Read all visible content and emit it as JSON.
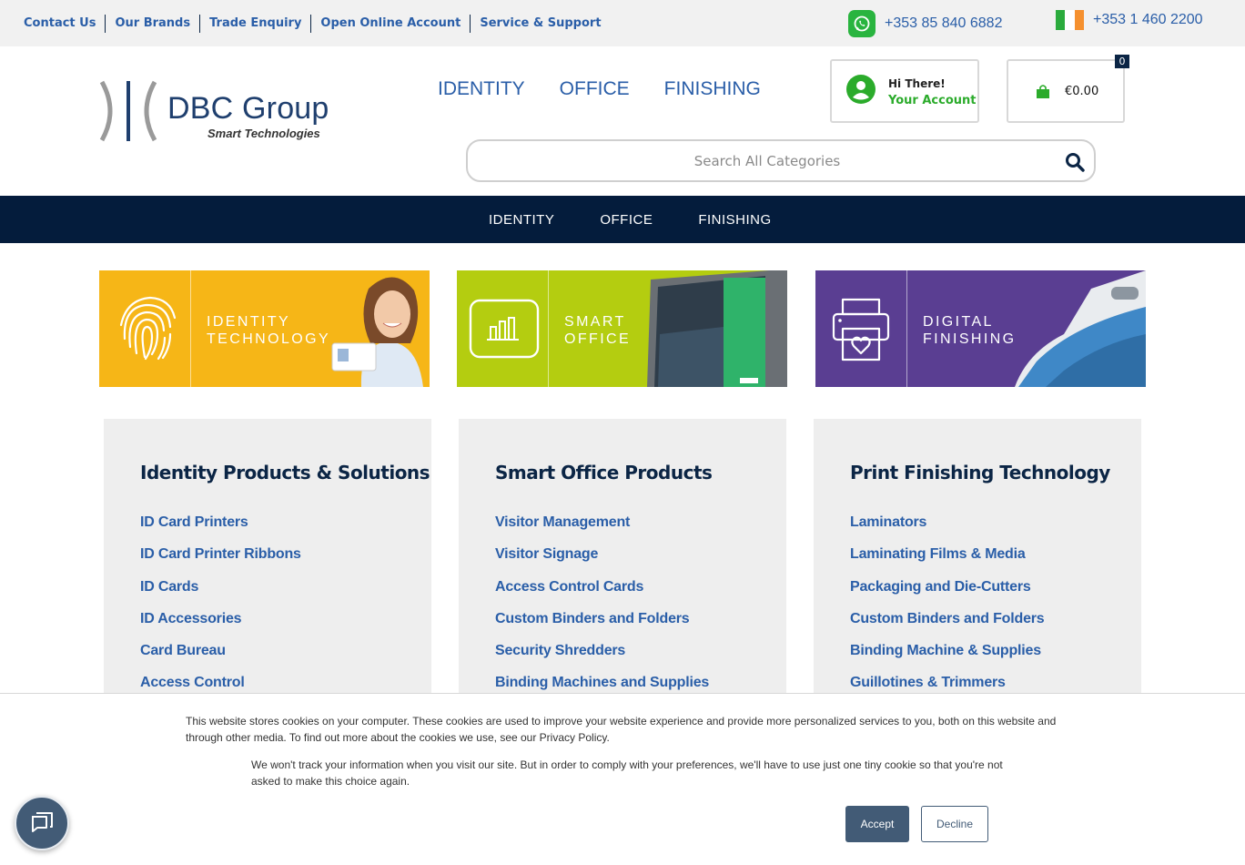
{
  "topbar": {
    "links": [
      "Contact Us",
      "Our Brands",
      "Trade Enquiry",
      "Open Online Account",
      "Service & Support"
    ],
    "whatsapp_phone": "+353 85 840 6882",
    "ireland_phone": "+353 1 460 2200"
  },
  "logo": {
    "name": "DBC Group",
    "tagline": "Smart Technologies"
  },
  "main_nav": [
    "IDENTITY",
    "OFFICE",
    "FINISHING"
  ],
  "account": {
    "greeting": "Hi There!",
    "link": "Your Account"
  },
  "cart": {
    "total": "€0.00",
    "count": "0"
  },
  "search": {
    "placeholder": "Search All Categories"
  },
  "category_nav": [
    "IDENTITY",
    "OFFICE",
    "FINISHING"
  ],
  "banners": [
    {
      "label": "IDENTITY\nTECHNOLOGY",
      "color": "#f6b617",
      "icon": "fingerprint-icon"
    },
    {
      "label": "SMART\nOFFICE",
      "color": "#b4cd10",
      "icon": "bar-chart-icon"
    },
    {
      "label": "DIGITAL\nFINISHING",
      "color": "#5a3e92",
      "icon": "printer-heart-icon"
    }
  ],
  "columns": [
    {
      "title": "Identity Products & Solutions",
      "items": [
        "ID Card Printers",
        "ID Card Printer Ribbons",
        "ID Cards",
        "ID Accessories",
        "Card Bureau",
        "Access Control"
      ]
    },
    {
      "title": "Smart Office Products",
      "items": [
        "Visitor Management",
        "Visitor Signage",
        "Access Control Cards",
        "Custom Binders and Folders",
        "Security Shredders",
        "Binding Machines and Supplies"
      ]
    },
    {
      "title": "Print Finishing Technology",
      "items": [
        "Laminators",
        "Laminating Films & Media",
        "Packaging and Die-Cutters",
        "Custom Binders and Folders",
        "Binding Machine & Supplies",
        "Guillotines & Trimmers"
      ]
    }
  ],
  "cookie": {
    "text1": "This website stores cookies on your computer. These cookies are used to improve your website experience and provide more personalized services to you, both on this website and through other media. To find out more about the cookies we use, see our Privacy Policy.",
    "text2": "We won't track your information when you visit our site. But in order to comply with your preferences, we'll have to use just one tiny cookie so that you're not asked to make this choice again.",
    "accept": "Accept",
    "decline": "Decline"
  },
  "colors": {
    "brand_navy": "#041c3c",
    "link_blue": "#2a5ea8",
    "green": "#2bab2b",
    "button": "#425b76"
  }
}
